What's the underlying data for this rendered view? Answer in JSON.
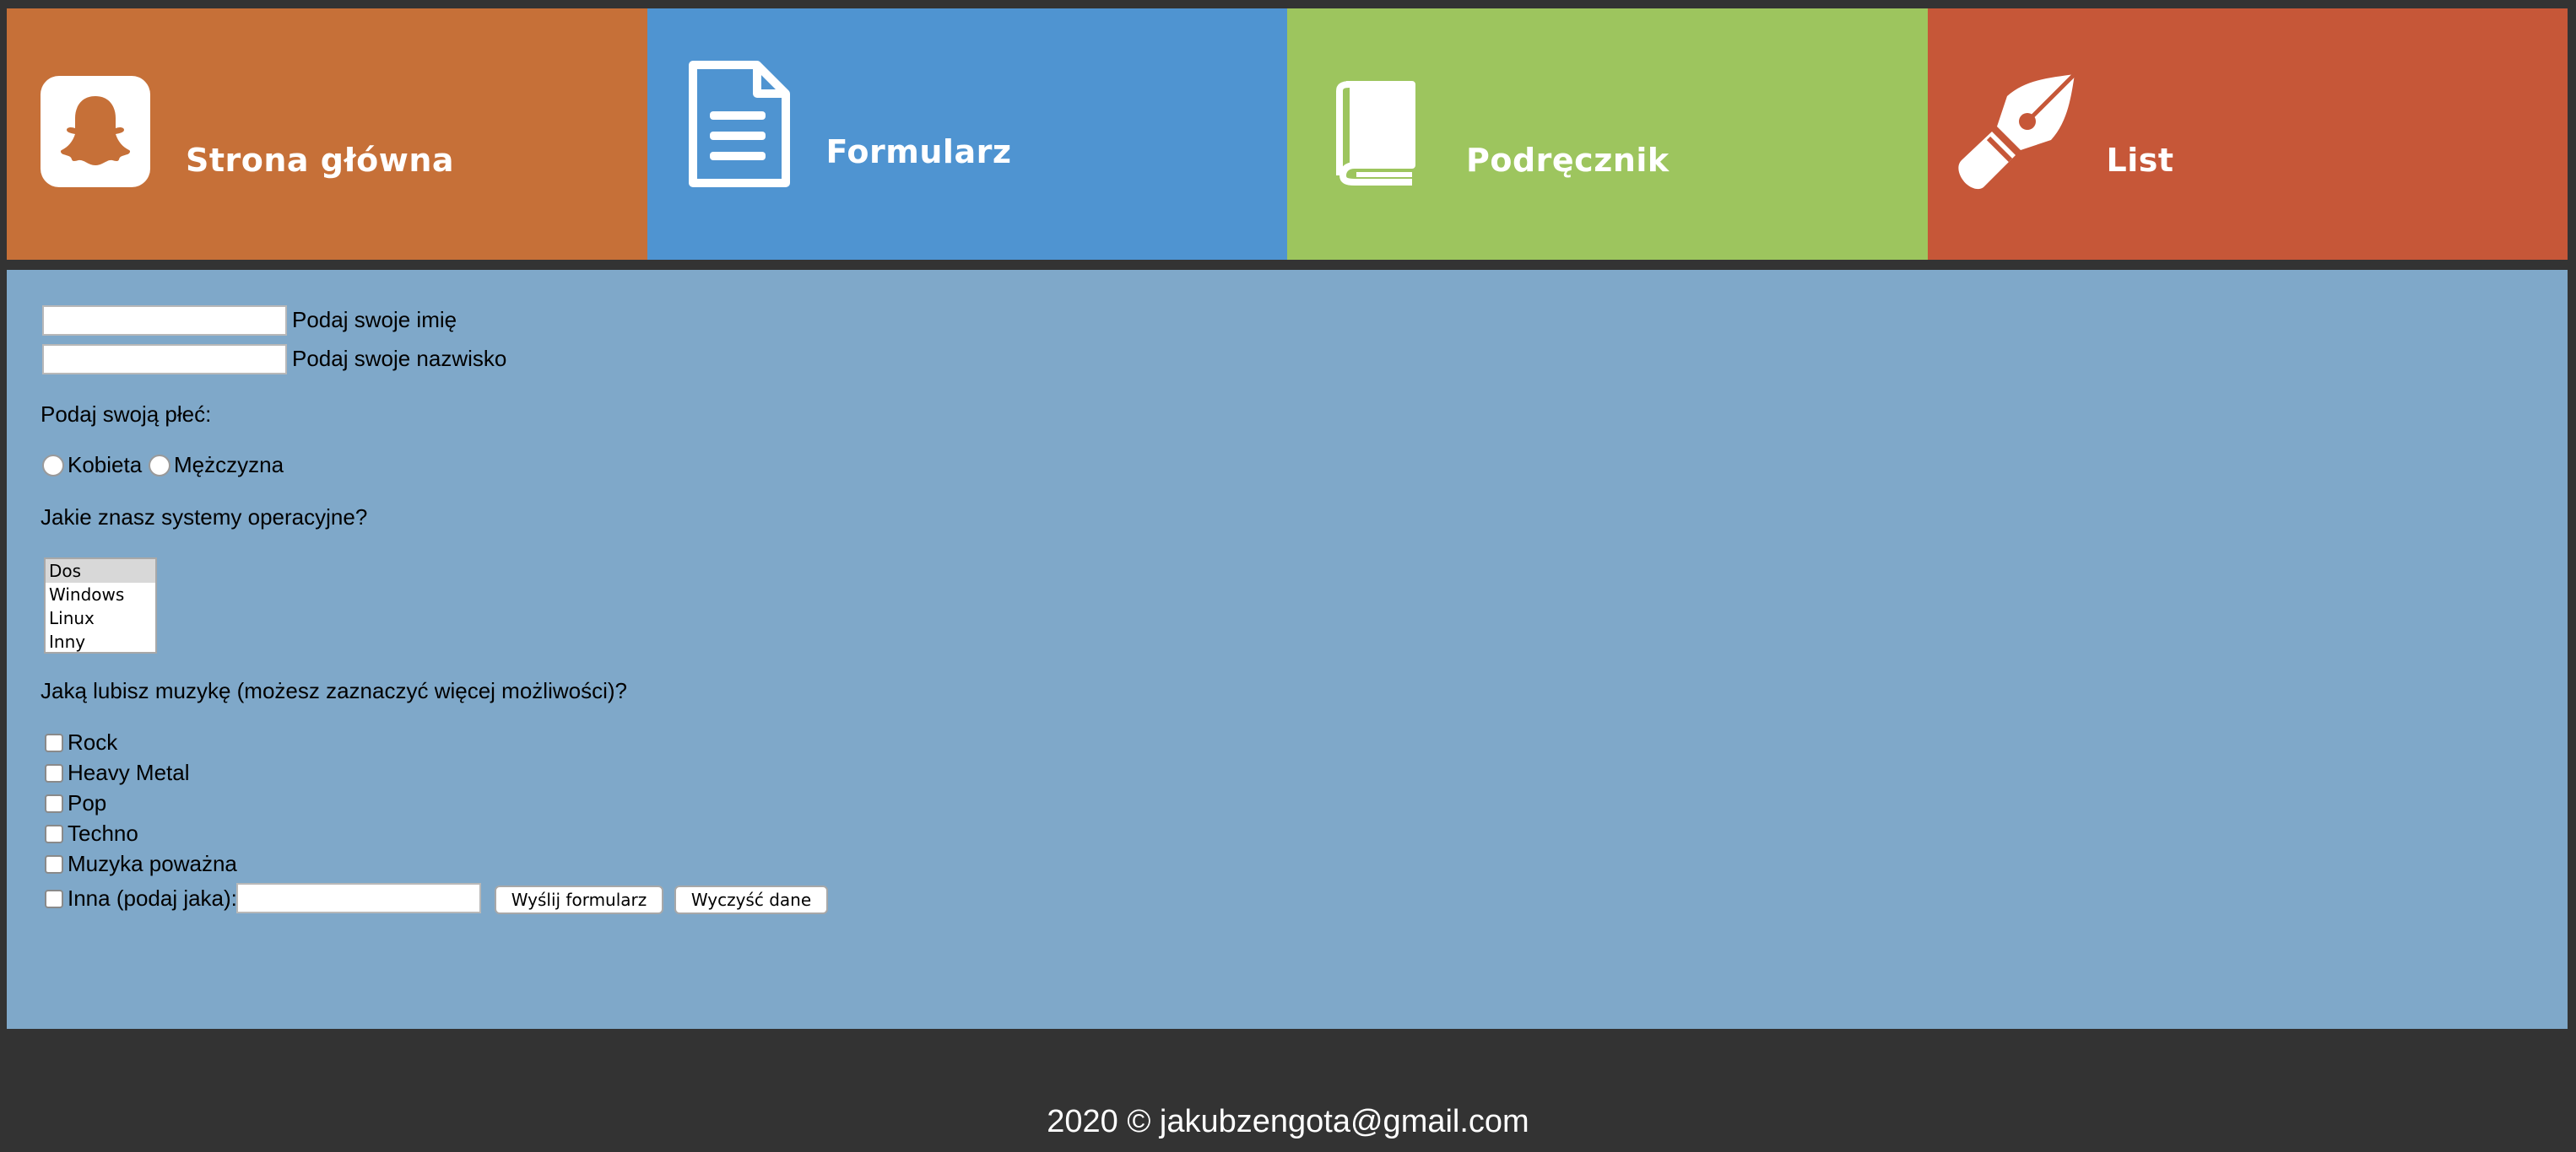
{
  "colors": {
    "page_bg": "#333333",
    "main_bg": "#7fa8c9",
    "tile_home": "#c67038",
    "tile_form": "#4f94d1",
    "tile_book": "#9dc55e",
    "tile_letter": "#c65738"
  },
  "nav": [
    {
      "label": "Strona główna",
      "icon": "snapchat-ghost-icon"
    },
    {
      "label": "Formularz",
      "icon": "document-icon"
    },
    {
      "label": "Podręcznik",
      "icon": "book-icon"
    },
    {
      "label": "List",
      "icon": "fountain-pen-icon"
    }
  ],
  "form": {
    "first_name": {
      "label": "Podaj swoje imię",
      "value": ""
    },
    "last_name": {
      "label": "Podaj swoje nazwisko",
      "value": ""
    },
    "gender_question": "Podaj swoją płeć:",
    "gender_options": [
      "Kobieta",
      "Mężczyzna"
    ],
    "os_question": "Jakie znasz systemy operacyjne?",
    "os_options": [
      "Dos",
      "Windows",
      "Linux",
      "Inny"
    ],
    "music_question": "Jaką lubisz muzykę (możesz zaznaczyć więcej możliwości)?",
    "music_options": [
      "Rock",
      "Heavy Metal",
      "Pop",
      "Techno",
      "Muzyka poważna",
      "Inna (podaj jaka):"
    ],
    "other_music_value": "",
    "submit_label": "Wyślij formularz",
    "reset_label": "Wyczyść dane"
  },
  "footer": {
    "text": "2020 © jakubzengota@gmail.com"
  }
}
